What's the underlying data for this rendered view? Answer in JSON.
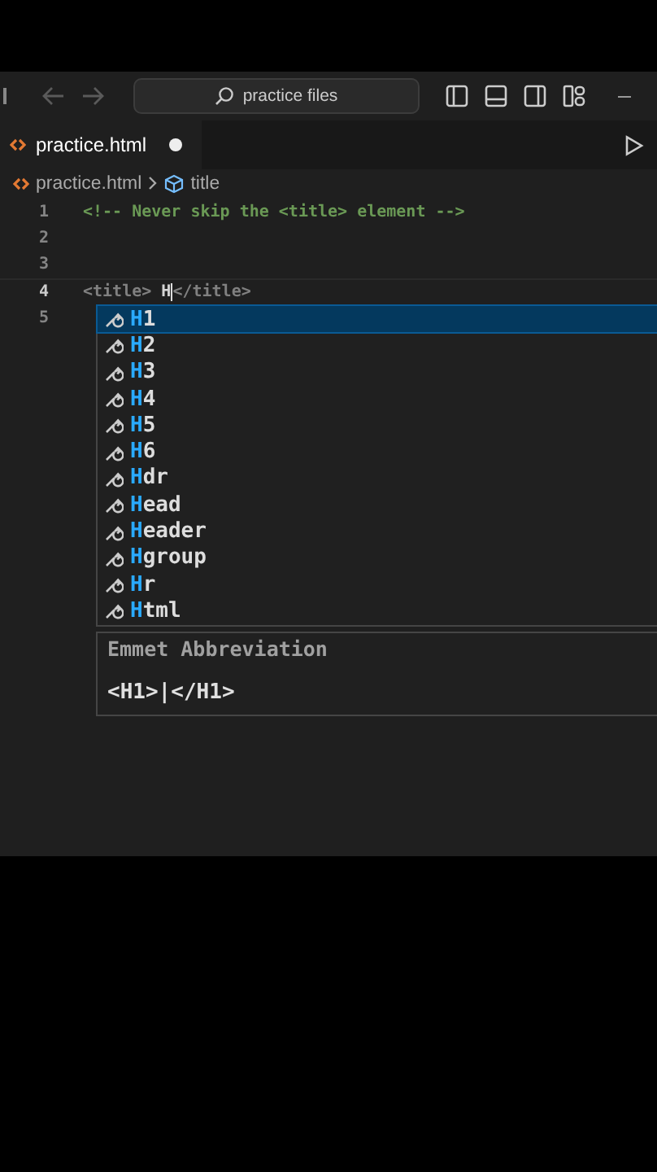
{
  "title_bar": {
    "search": "practice files"
  },
  "tabs": [
    {
      "label": "practice.html",
      "selected": true,
      "modified": true
    }
  ],
  "breadcrumb": {
    "file": "practice.html",
    "symbol": "title"
  },
  "lines": [
    {
      "number": "1",
      "current": false,
      "tokens": [
        {
          "text": "<!-- Never skip the <title> element -->",
          "kind": "comment"
        }
      ]
    },
    {
      "number": "2",
      "current": false
    },
    {
      "number": "3",
      "current": false
    },
    {
      "number": "4",
      "current": true,
      "tokens": [
        {
          "text": "<title>",
          "kind": "tag"
        },
        {
          "text": " H",
          "kind": "text",
          "cursor": true
        },
        {
          "text": "</title>",
          "kind": "tag"
        }
      ]
    },
    {
      "number": "5",
      "current": false
    }
  ],
  "suggestions": [
    {
      "match": "H",
      "rest": "1",
      "selected": true
    },
    {
      "match": "H",
      "rest": "2",
      "selected": false
    },
    {
      "match": "H",
      "rest": "3",
      "selected": false
    },
    {
      "match": "H",
      "rest": "4",
      "selected": false
    },
    {
      "match": "H",
      "rest": "5",
      "selected": false
    },
    {
      "match": "H",
      "rest": "6",
      "selected": false
    },
    {
      "match": "H",
      "rest": "dr",
      "selected": false
    },
    {
      "match": "H",
      "rest": "ead",
      "selected": false
    },
    {
      "match": "H",
      "rest": "eader",
      "selected": false
    },
    {
      "match": "H",
      "rest": "group",
      "selected": false
    },
    {
      "match": "H",
      "rest": "r",
      "selected": false
    },
    {
      "match": "H",
      "rest": "tml",
      "selected": false
    }
  ],
  "details": {
    "title": "Emmet Abbreviation",
    "preview": "<H1>|</H1>"
  }
}
